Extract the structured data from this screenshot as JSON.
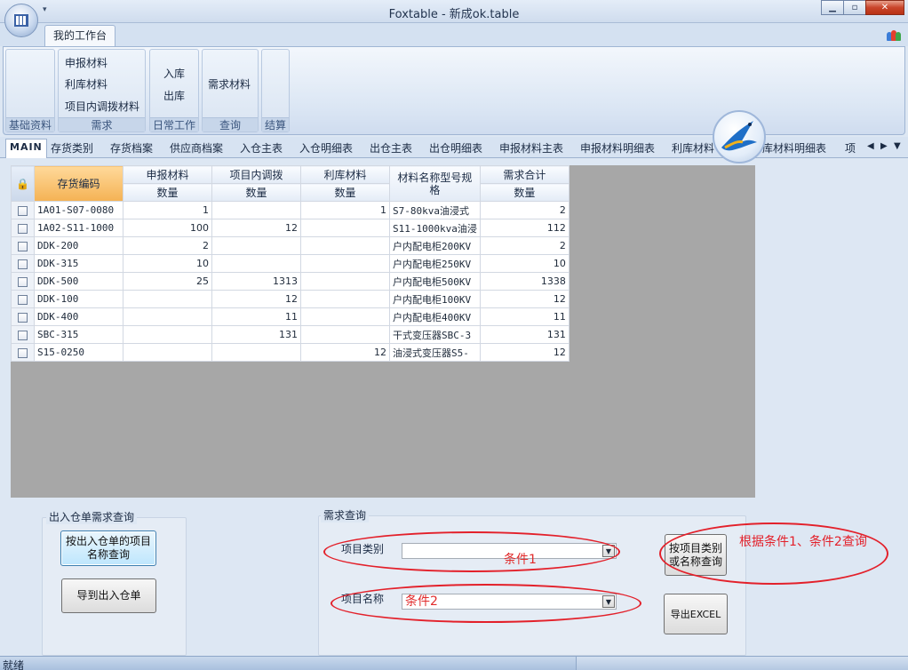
{
  "window": {
    "title": "Foxtable - 新成ok.table"
  },
  "ribbon": {
    "tab": "我的工作台",
    "groups": [
      {
        "label": "基础资料",
        "buttons": []
      },
      {
        "label": "需求",
        "buttons": [
          "申报材料",
          "利库材料",
          "项目内调拨材料"
        ]
      },
      {
        "label": "日常工作",
        "buttons": [
          "入库",
          "出库"
        ]
      },
      {
        "label": "查询",
        "buttons": [
          "需求材料"
        ]
      },
      {
        "label": "结算",
        "buttons": []
      }
    ]
  },
  "doc_tabs": [
    "MAIN",
    "存货类别",
    "存货档案",
    "供应商档案",
    "入仓主表",
    "入仓明细表",
    "出仓主表",
    "出仓明细表",
    "申报材料主表",
    "申报材料明细表",
    "利库材料",
    "库材料明细表",
    "项"
  ],
  "table": {
    "headers_top": [
      "存货编码",
      "申报材料",
      "项目内调拨",
      "利库材料",
      "材料名称型号规格",
      "需求合计"
    ],
    "headers_sub": [
      "数量",
      "数量",
      "数量",
      "数量"
    ],
    "rows": [
      {
        "code": "1A01-S07-0080",
        "sb": "1",
        "db": "",
        "lk": "1",
        "name": "S7-80kva油浸式",
        "total": "2"
      },
      {
        "code": "1A02-S11-1000",
        "sb": "100",
        "db": "12",
        "lk": "",
        "name": "S11-1000kva油浸",
        "total": "112"
      },
      {
        "code": "DDK-200",
        "sb": "2",
        "db": "",
        "lk": "",
        "name": "户内配电柜200KV",
        "total": "2"
      },
      {
        "code": "DDK-315",
        "sb": "10",
        "db": "",
        "lk": "",
        "name": "户内配电柜250KV",
        "total": "10"
      },
      {
        "code": "DDK-500",
        "sb": "25",
        "db": "1313",
        "lk": "",
        "name": "户内配电柜500KV",
        "total": "1338"
      },
      {
        "code": "DDK-100",
        "sb": "",
        "db": "12",
        "lk": "",
        "name": "户内配电柜100KV",
        "total": "12"
      },
      {
        "code": "DDK-400",
        "sb": "",
        "db": "11",
        "lk": "",
        "name": "户内配电柜400KV",
        "total": "11"
      },
      {
        "code": "SBC-315",
        "sb": "",
        "db": "131",
        "lk": "",
        "name": "干式变压器SBC-3",
        "total": "131"
      },
      {
        "code": "S15-0250",
        "sb": "",
        "db": "",
        "lk": "12",
        "name": "油浸式变压器S5-",
        "total": "12"
      }
    ]
  },
  "left_panel": {
    "title": "出入仓单需求查询",
    "btn_query": "按出入仓单的项目名称查询",
    "btn_goto": "导到出入仓单"
  },
  "right_panel": {
    "title": "需求查询",
    "label_type": "项目类别",
    "label_name": "项目名称",
    "combo_type_value": "条件1",
    "combo_name_value": "条件2",
    "btn_query": "按项目类别或名称查询",
    "btn_excel": "导出EXCEL",
    "annotation": "根据条件1、条件2查询"
  },
  "status": {
    "text": "就绪"
  }
}
